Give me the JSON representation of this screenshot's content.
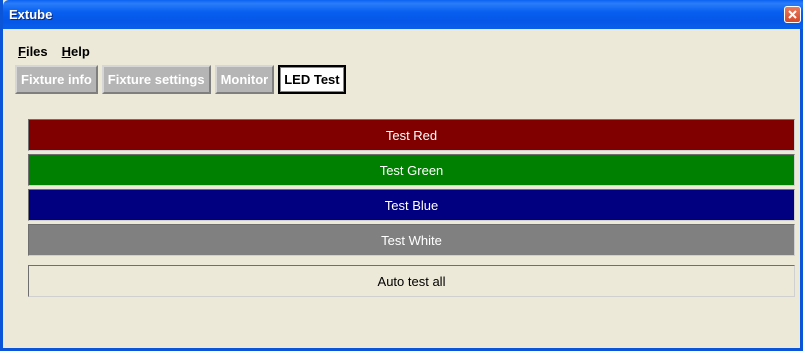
{
  "window": {
    "title": "Extube"
  },
  "menu": {
    "files_first": "F",
    "files_rest": "iles",
    "help_first": "H",
    "help_rest": "elp"
  },
  "tabs": [
    {
      "label": "Fixture info",
      "active": false
    },
    {
      "label": "Fixture settings",
      "active": false
    },
    {
      "label": "Monitor",
      "active": false
    },
    {
      "label": "LED Test",
      "active": true
    }
  ],
  "led_test": {
    "red": "Test Red",
    "green": "Test Green",
    "blue": "Test Blue",
    "white": "Test White",
    "auto": "Auto test all"
  },
  "colors": {
    "red": "#800000",
    "green": "#008000",
    "blue": "#000080",
    "white": "#808080",
    "titlebar": "#0a5fe8"
  },
  "icons": {
    "close": "close-icon"
  }
}
